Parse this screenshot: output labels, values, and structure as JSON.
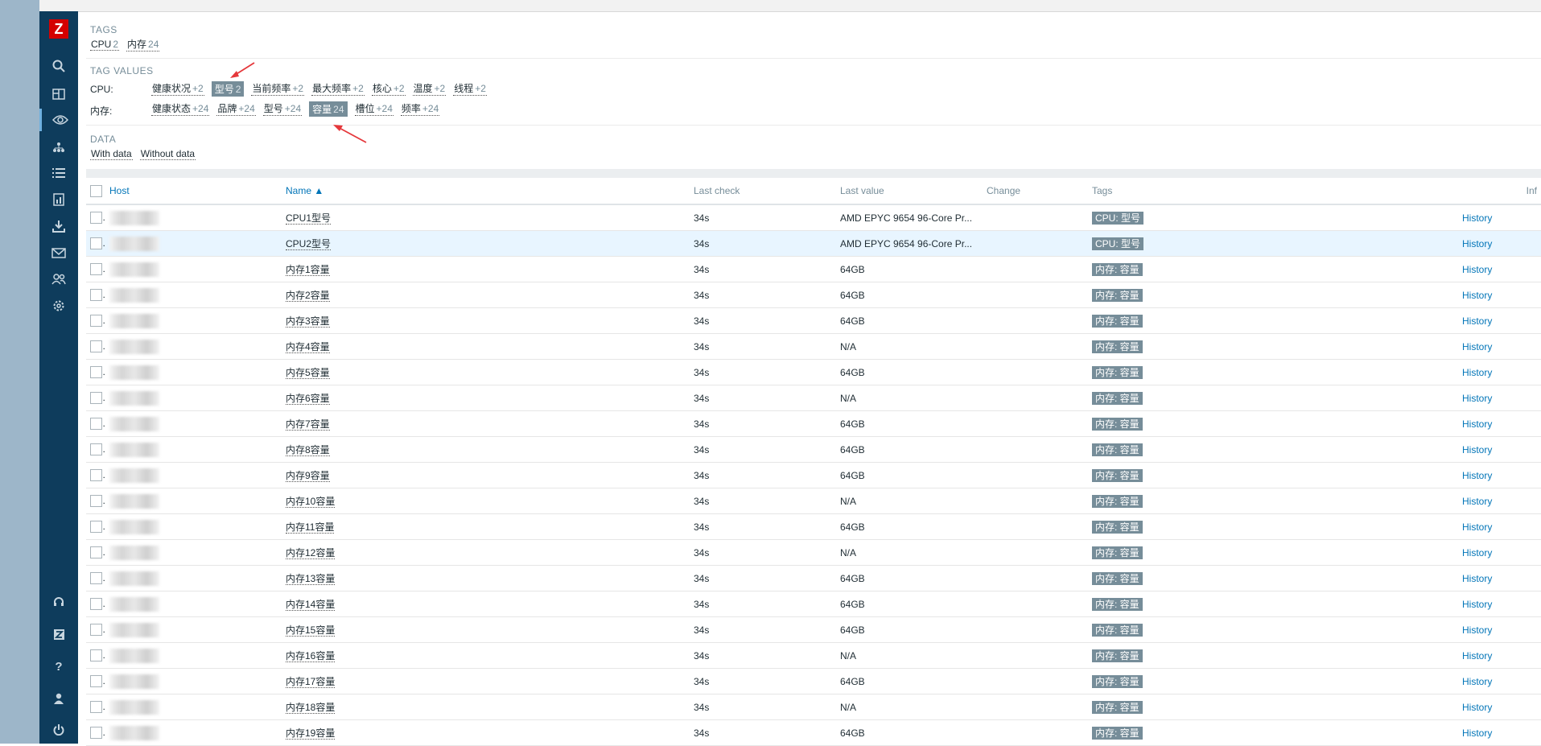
{
  "filter": {
    "tags_title": "TAGS",
    "tags": [
      {
        "label": "CPU",
        "count": "2"
      },
      {
        "label": "内存",
        "count": "24"
      }
    ],
    "tag_values_title": "TAG VALUES",
    "cpu_label": "CPU:",
    "cpu_values": [
      {
        "label": "健康状况",
        "count": "+2",
        "selected": false
      },
      {
        "label": "型号",
        "count": "2",
        "selected": true
      },
      {
        "label": "当前频率",
        "count": "+2",
        "selected": false
      },
      {
        "label": "最大频率",
        "count": "+2",
        "selected": false
      },
      {
        "label": "核心",
        "count": "+2",
        "selected": false
      },
      {
        "label": "温度",
        "count": "+2",
        "selected": false
      },
      {
        "label": "线程",
        "count": "+2",
        "selected": false
      }
    ],
    "mem_label": "内存:",
    "mem_values": [
      {
        "label": "健康状态",
        "count": "+24",
        "selected": false
      },
      {
        "label": "品牌",
        "count": "+24",
        "selected": false
      },
      {
        "label": "型号",
        "count": "+24",
        "selected": false
      },
      {
        "label": "容量",
        "count": "24",
        "selected": true
      },
      {
        "label": "槽位",
        "count": "+24",
        "selected": false
      },
      {
        "label": "频率",
        "count": "+24",
        "selected": false
      }
    ],
    "data_title": "DATA",
    "data_options": [
      "With data",
      "Without data"
    ]
  },
  "table": {
    "headers": {
      "host": "Host",
      "name": "Name ▲",
      "last_check": "Last check",
      "last_value": "Last value",
      "change": "Change",
      "tags": "Tags",
      "info": "Inf"
    },
    "rows": [
      {
        "name": "CPU1型号",
        "last_check": "34s",
        "last_value": "AMD EPYC 9654 96-Core Pr...",
        "tag": "CPU: 型号",
        "action": "History"
      },
      {
        "name": "CPU2型号",
        "last_check": "34s",
        "last_value": "AMD EPYC 9654 96-Core Pr...",
        "tag": "CPU: 型号",
        "action": "History"
      },
      {
        "name": "内存1容量",
        "last_check": "34s",
        "last_value": "64GB",
        "tag": "内存: 容量",
        "action": "History"
      },
      {
        "name": "内存2容量",
        "last_check": "34s",
        "last_value": "64GB",
        "tag": "内存: 容量",
        "action": "History"
      },
      {
        "name": "内存3容量",
        "last_check": "34s",
        "last_value": "64GB",
        "tag": "内存: 容量",
        "action": "History"
      },
      {
        "name": "内存4容量",
        "last_check": "34s",
        "last_value": "N/A",
        "tag": "内存: 容量",
        "action": "History"
      },
      {
        "name": "内存5容量",
        "last_check": "34s",
        "last_value": "64GB",
        "tag": "内存: 容量",
        "action": "History"
      },
      {
        "name": "内存6容量",
        "last_check": "34s",
        "last_value": "N/A",
        "tag": "内存: 容量",
        "action": "History"
      },
      {
        "name": "内存7容量",
        "last_check": "34s",
        "last_value": "64GB",
        "tag": "内存: 容量",
        "action": "History"
      },
      {
        "name": "内存8容量",
        "last_check": "34s",
        "last_value": "64GB",
        "tag": "内存: 容量",
        "action": "History"
      },
      {
        "name": "内存9容量",
        "last_check": "34s",
        "last_value": "64GB",
        "tag": "内存: 容量",
        "action": "History"
      },
      {
        "name": "内存10容量",
        "last_check": "34s",
        "last_value": "N/A",
        "tag": "内存: 容量",
        "action": "History"
      },
      {
        "name": "内存11容量",
        "last_check": "34s",
        "last_value": "64GB",
        "tag": "内存: 容量",
        "action": "History"
      },
      {
        "name": "内存12容量",
        "last_check": "34s",
        "last_value": "N/A",
        "tag": "内存: 容量",
        "action": "History"
      },
      {
        "name": "内存13容量",
        "last_check": "34s",
        "last_value": "64GB",
        "tag": "内存: 容量",
        "action": "History"
      },
      {
        "name": "内存14容量",
        "last_check": "34s",
        "last_value": "64GB",
        "tag": "内存: 容量",
        "action": "History"
      },
      {
        "name": "内存15容量",
        "last_check": "34s",
        "last_value": "64GB",
        "tag": "内存: 容量",
        "action": "History"
      },
      {
        "name": "内存16容量",
        "last_check": "34s",
        "last_value": "N/A",
        "tag": "内存: 容量",
        "action": "History"
      },
      {
        "name": "内存17容量",
        "last_check": "34s",
        "last_value": "64GB",
        "tag": "内存: 容量",
        "action": "History"
      },
      {
        "name": "内存18容量",
        "last_check": "34s",
        "last_value": "N/A",
        "tag": "内存: 容量",
        "action": "History"
      },
      {
        "name": "内存19容量",
        "last_check": "34s",
        "last_value": "64GB",
        "tag": "内存: 容量",
        "action": "History"
      }
    ]
  },
  "sidebar": {
    "logo": "Z",
    "icons": [
      "search-icon",
      "dashboard-icon",
      "monitoring-eye-icon",
      "network-map-icon",
      "inventory-list-icon",
      "reports-icon",
      "data-collection-icon",
      "alerts-mail-icon",
      "users-icon",
      "settings-gear-icon",
      "support-headset-icon",
      "zabbix-integrations-icon",
      "help-icon",
      "user-profile-icon",
      "sign-out-icon"
    ],
    "help_glyph": "?"
  },
  "colors": {
    "sidebar": "#0e3c5c",
    "accent_link": "#0275b8",
    "tag_chip": "#768d99",
    "row_highlight": "#e8f5ff",
    "annotation_arrow": "#e5373b"
  }
}
